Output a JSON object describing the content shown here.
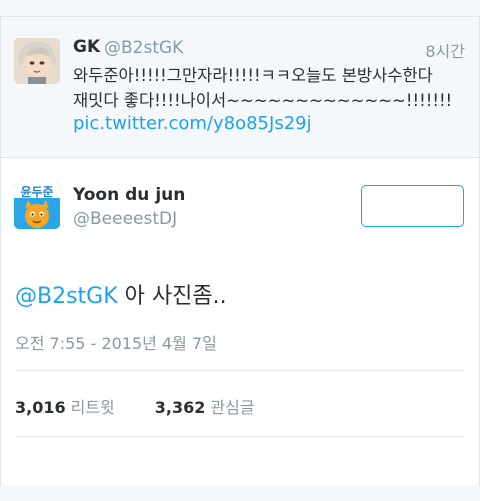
{
  "parent_tweet": {
    "name": "GK",
    "handle": "@B2stGK",
    "time": "8시간",
    "text": "와두준아!!!!!그만자라!!!!!ㅋㅋ오늘도 본방사수한다\n재밋다 좋다!!!!나이서~~~~~~~~~~~~~!!!!!!!",
    "link": "pic.twitter.com/y8o85Js29j"
  },
  "main_tweet": {
    "name": "Yoon du jun",
    "handle": "@BeeeestDJ",
    "avatar_text": "윤두준",
    "mention": "@B2stGK",
    "text": " 아 사진좀..",
    "date": "오전 7:55 - 2015년 4월 7일",
    "retweets": {
      "count": "3,016",
      "label": "리트윗"
    },
    "favorites": {
      "count": "3,362",
      "label": "관심글"
    }
  },
  "colors": {
    "accent": "#1da1f2",
    "secondary_text": "#8899a6",
    "primary_text": "#292f33",
    "border": "#e1e8ed"
  }
}
